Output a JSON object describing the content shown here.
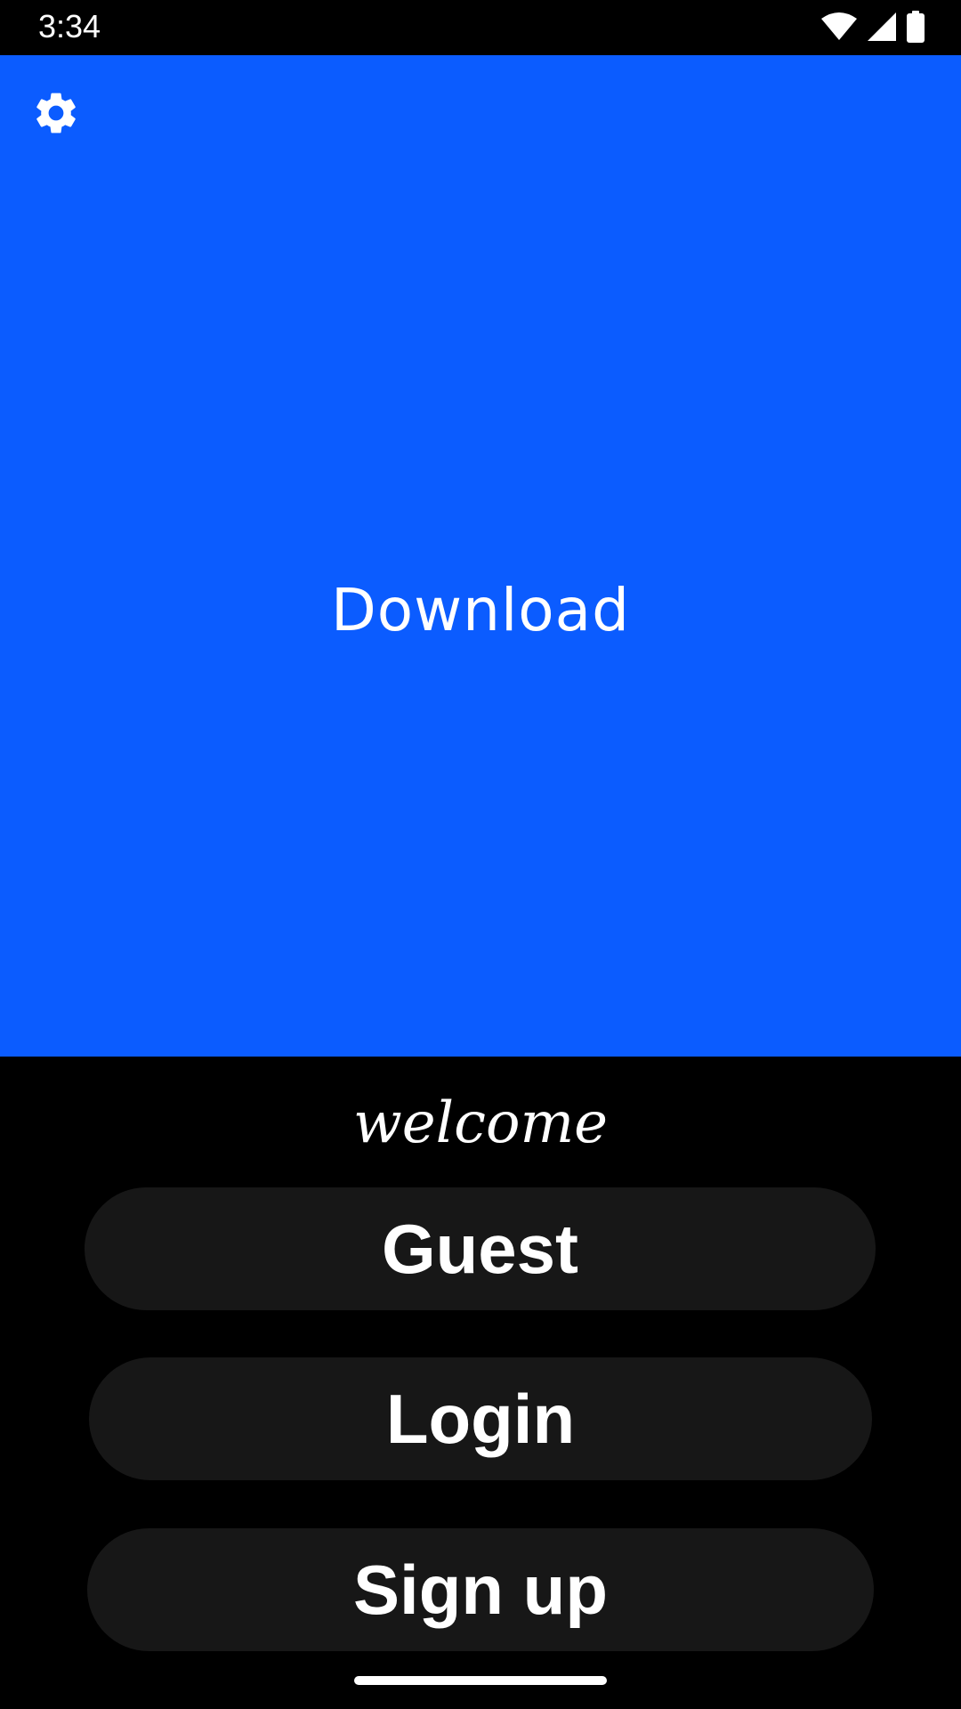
{
  "status_bar": {
    "time": "3:34",
    "icons": [
      "wifi-icon",
      "cell-signal-icon",
      "battery-icon"
    ]
  },
  "hero": {
    "background_color": "#0b5cff",
    "settings_icon": "gear-icon",
    "download_label": "Download"
  },
  "welcome": {
    "text": "welcome"
  },
  "buttons": {
    "guest_label": "Guest",
    "login_label": "Login",
    "signup_label": "Sign up",
    "background_color": "#171717"
  }
}
